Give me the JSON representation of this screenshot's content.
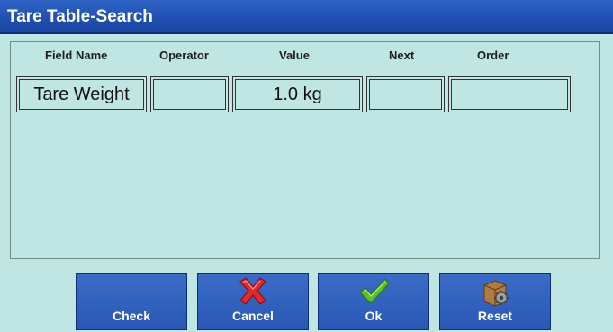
{
  "window": {
    "title": "Tare Table-Search"
  },
  "table": {
    "headers": {
      "field_name": "Field Name",
      "operator": "Operator",
      "value": "Value",
      "next": "Next",
      "order": "Order"
    },
    "row": {
      "field_name": "Tare Weight",
      "operator": "",
      "value": "1.0 kg",
      "next": "",
      "order": ""
    }
  },
  "buttons": {
    "check": {
      "label": "Check",
      "icon": "check-icon-none"
    },
    "cancel": {
      "label": "Cancel",
      "icon": "red-x-icon"
    },
    "ok": {
      "label": "Ok",
      "icon": "green-checkmark-icon"
    },
    "reset": {
      "label": "Reset",
      "icon": "box-gear-icon"
    }
  },
  "colors": {
    "titlebar": "#1f4fb0",
    "background": "#bfe6e3",
    "button": "#2a59b4"
  }
}
